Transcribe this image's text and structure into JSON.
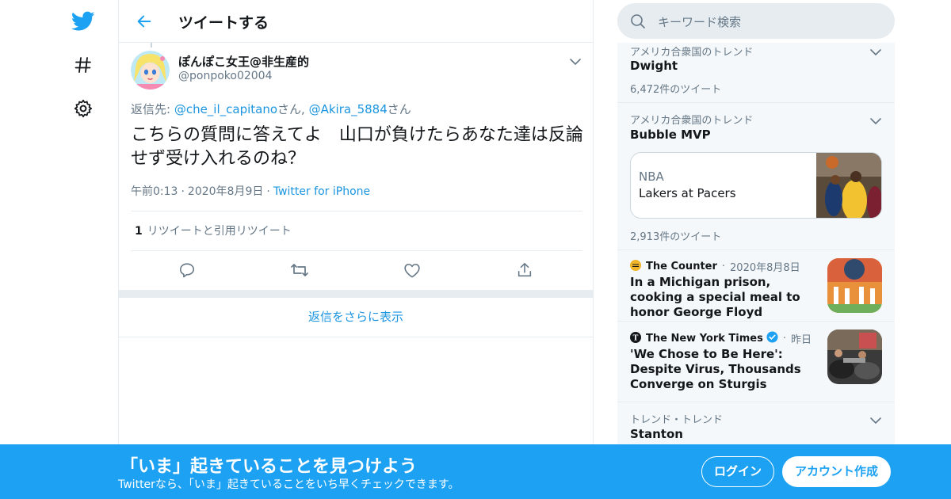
{
  "header": {
    "title": "ツイートする"
  },
  "nav": {
    "icons": [
      "twitter-logo-icon",
      "hashtag-icon",
      "settings-icon"
    ]
  },
  "tweet": {
    "display_name": "ぽんぽこ女王@非生産的",
    "handle": "@ponpoko02004",
    "reply_prefix": "返信先: ",
    "reply_users": [
      "@che_il_capitano",
      "@Akira_5884"
    ],
    "reply_suffix": "さん",
    "reply_comma": ", ",
    "text": "こちらの質問に答えてよ　山口が負けたらあなた達は反論せず受け入れるのね？",
    "time": "午前0:13",
    "date": "2020年8月9日",
    "source": "Twitter for iPhone",
    "retweet_count": "1",
    "retweet_label": "リツイートと引用リツイート",
    "more_replies": "返信をさらに表示"
  },
  "search": {
    "placeholder": "キーワード検索"
  },
  "trends": [
    {
      "context": "アメリカ合衆国のトレンド",
      "name": "Dwight",
      "count": "6,472件のツイート"
    },
    {
      "context": "アメリカ合衆国のトレンド",
      "name": "Bubble MVP",
      "card_category": "NBA",
      "card_title": "Lakers at Pacers",
      "count": "2,913件のツイート"
    },
    {
      "context": "トレンド・トレンド",
      "name": "Stanton"
    }
  ],
  "news": [
    {
      "source": "The Counter",
      "time": "2020年8月8日",
      "title": "In a Michigan prison, cooking a special meal to honor George Floyd"
    },
    {
      "source": "The New York Times",
      "time": "昨日",
      "title": "'We Chose to Be Here': Despite Virus, Thousands Converge on Sturgis",
      "verified": true
    }
  ],
  "banner": {
    "title": "「いま」起きていることを見つけよう",
    "subtitle": "Twitterなら、「いま」起きていることをいち早くチェックできます。",
    "login": "ログイン",
    "signup": "アカウント作成"
  },
  "colors": {
    "brand": "#1da1f2",
    "link": "#1b95e0",
    "muted": "#657786",
    "border": "#e6ecf0"
  }
}
